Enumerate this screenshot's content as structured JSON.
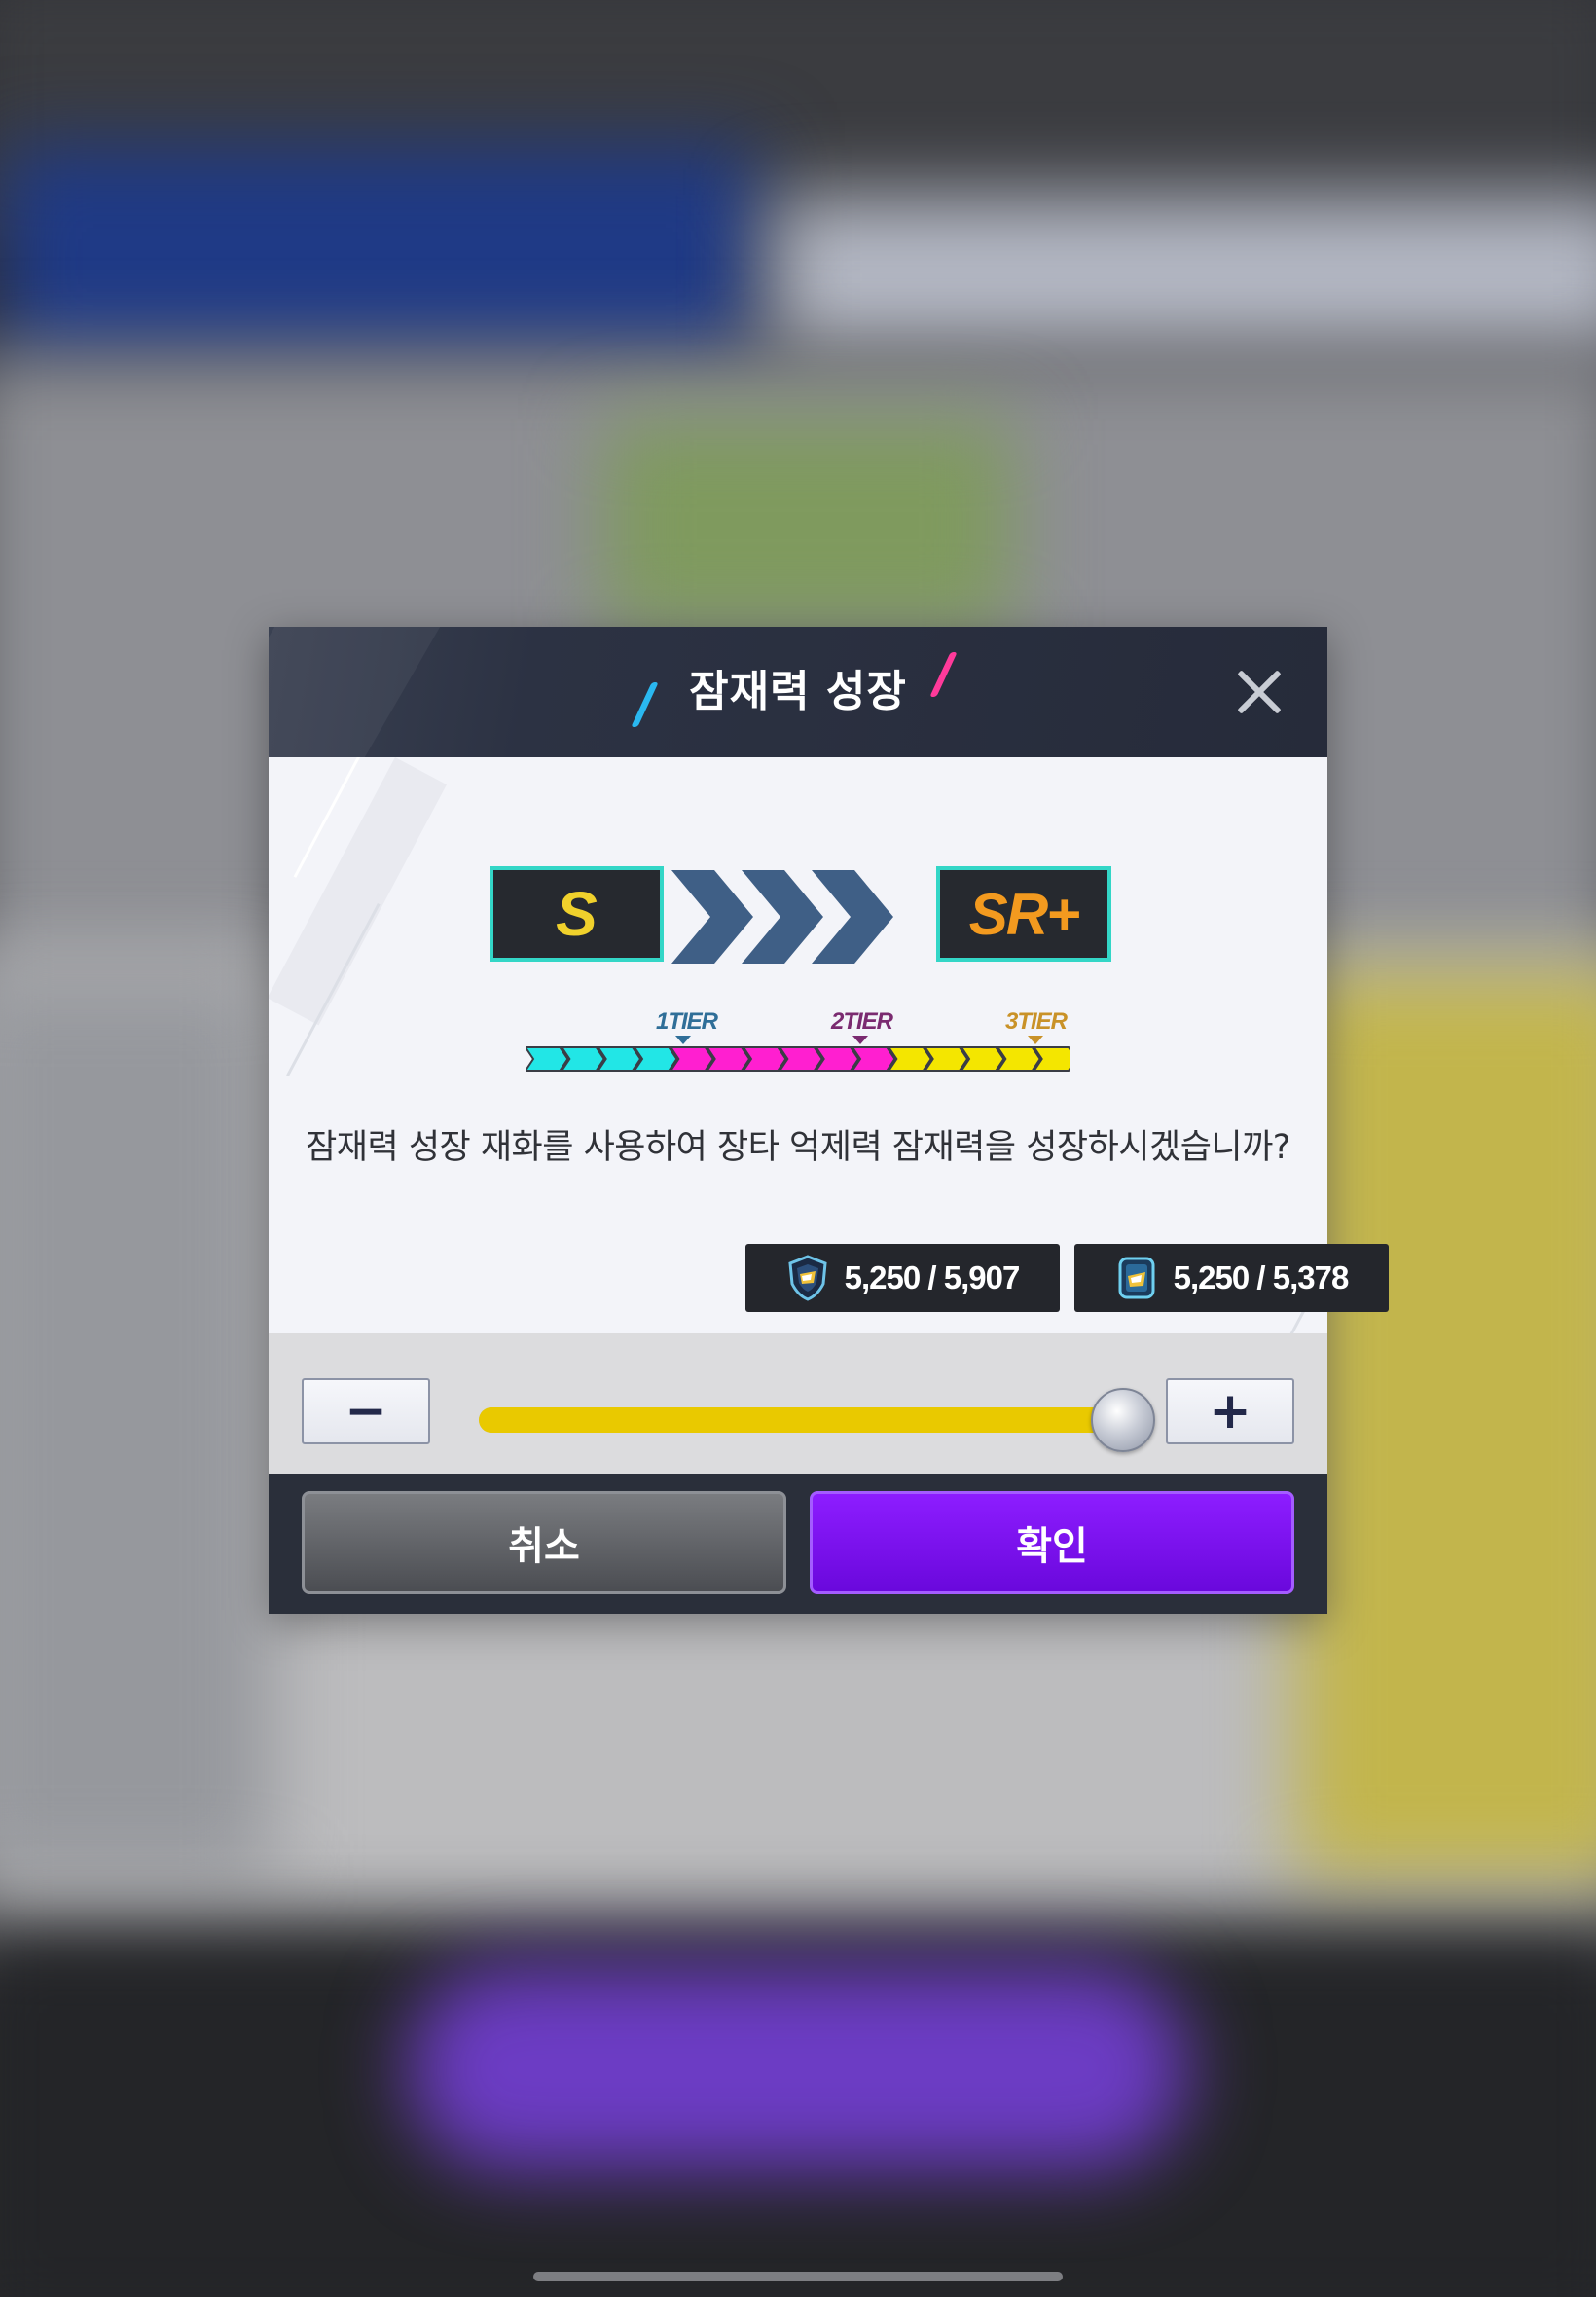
{
  "dialog": {
    "title": "잠재력 성장",
    "close_icon": "close-icon",
    "grade_from": "S",
    "grade_to": "SR+",
    "tiers": [
      "1TIER",
      "2TIER",
      "3TIER"
    ],
    "track_segments": {
      "colors": [
        "#22e6e6",
        "#ff1fd0",
        "#f4e600"
      ],
      "counts": [
        4,
        6,
        5
      ]
    },
    "question": "잠재력 성장 재화를 사용하여 장타 억제력 잠재력을 성장하시겠습니까?",
    "resources": [
      {
        "icon": "shield-emblem-icon",
        "text": "5,250 / 5,907"
      },
      {
        "icon": "card-pack-icon",
        "text": "5,250 / 5,378"
      }
    ],
    "slider": {
      "value": 1.0,
      "minus_label": "−",
      "plus_label": "+"
    },
    "buttons": {
      "cancel": "취소",
      "confirm": "확인"
    }
  },
  "colors": {
    "accent_purple": "#7a10f0",
    "slider_fill": "#e9c900",
    "grade_border": "#33d6c7",
    "grade_from_text": "#f0d12c",
    "grade_to_text": "#f39a1f"
  }
}
